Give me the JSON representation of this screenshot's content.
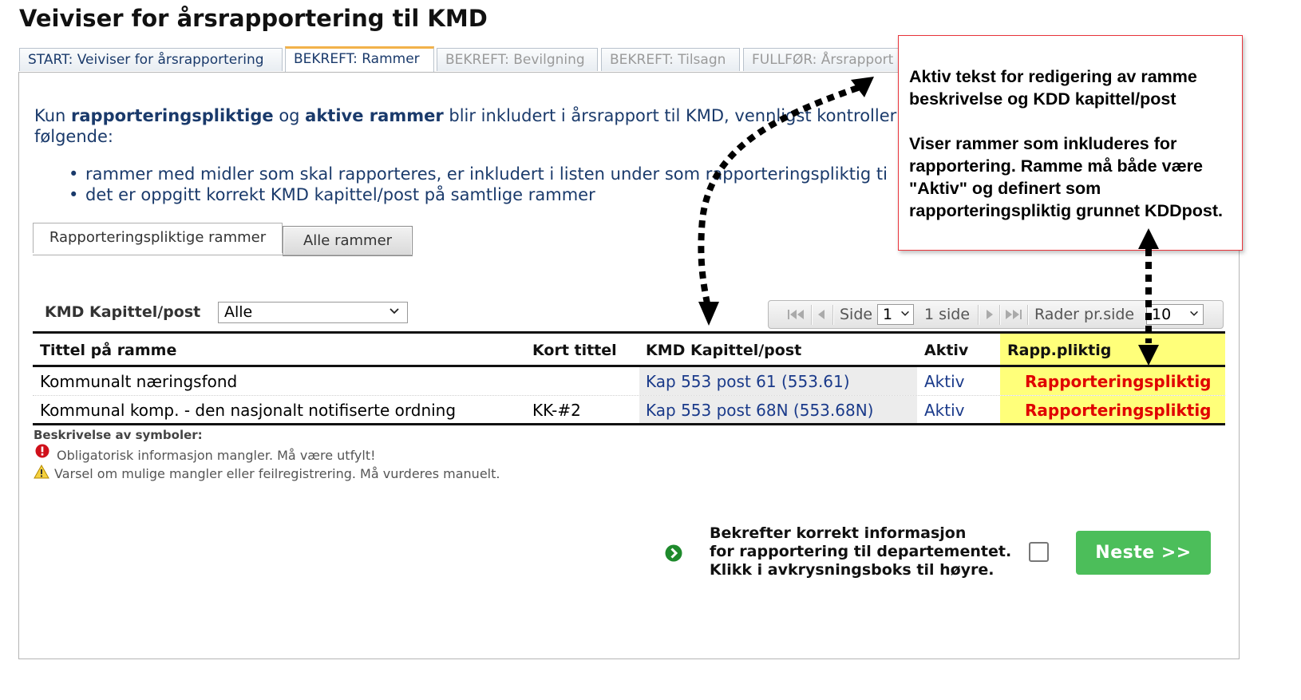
{
  "page": {
    "title": "Veiviser for årsrapportering til KMD"
  },
  "wizard_tabs": [
    {
      "label": "START: Veiviser for årsrapportering",
      "state": "done"
    },
    {
      "label": "BEKREFT: Rammer",
      "state": "active"
    },
    {
      "label": "BEKREFT: Bevilgning",
      "state": "disabled"
    },
    {
      "label": "BEKREFT: Tilsagn",
      "state": "disabled"
    },
    {
      "label": "FULLFØR: Årsrapport",
      "state": "disabled"
    }
  ],
  "intro": {
    "prefix": "Kun ",
    "bold1": "rapporteringspliktige",
    "mid": " og ",
    "bold2": "aktive rammer",
    "suffix": " blir inkludert i årsrapport til KMD, vennligst kontroller følgende:",
    "bullets": [
      "rammer med midler som skal rapporteres, er inkludert i listen under som rapporteringspliktig ti",
      "det er oppgitt korrekt KMD kapittel/post på samtlige rammer"
    ]
  },
  "view_tabs": {
    "selected": "Rapporteringspliktige rammer",
    "other": "Alle rammer"
  },
  "filter": {
    "label": "KMD Kapittel/post",
    "value": "Alle"
  },
  "pager": {
    "page_label": "Side",
    "page_value": "1",
    "page_count": "1 side",
    "rows_label": "Rader pr.side",
    "rows_value": "10"
  },
  "table": {
    "headers": {
      "title": "Tittel på ramme",
      "short": "Kort tittel",
      "kmd": "KMD Kapittel/post",
      "active": "Aktiv",
      "rapp": "Rapp.pliktig"
    },
    "rows": [
      {
        "title": "Kommunalt næringsfond",
        "short": "",
        "kmd": "Kap 553 post 61 (553.61)",
        "active": "Aktiv",
        "rapp": "Rapporteringspliktig"
      },
      {
        "title": "Kommunal komp. - den nasjonalt notifiserte ordning",
        "short": "KK-#2",
        "kmd": "Kap 553 post 68N (553.68N)",
        "active": "Aktiv",
        "rapp": "Rapporteringspliktig"
      }
    ]
  },
  "legend": {
    "title": "Beskrivelse av symboler:",
    "error": "Obligatorisk informasjon mangler. Må være utfylt!",
    "warning": "Varsel om mulige mangler eller feilregistrering. Må vurderes manuelt."
  },
  "confirm": {
    "line1": "Bekrefter korrekt informasjon",
    "line2": "for rapportering til departementet.",
    "line3": "Klikk i avkrysningsboks til høyre.",
    "next_label": "Neste >>"
  },
  "callout": {
    "para1": "Aktiv tekst for redigering av ramme beskrivelse og KDD kapittel/post",
    "para2": "Viser rammer som inkluderes for rapportering. Ramme må både være \"Aktiv\" og definert som rapporteringspliktig grunnet KDDpost."
  },
  "colors": {
    "accent_text": "#1a3a6b",
    "required_red": "#e00000",
    "highlight_yellow": "#ffff7a",
    "next_green": "#4cbe5a",
    "callout_border": "#e8333a"
  }
}
